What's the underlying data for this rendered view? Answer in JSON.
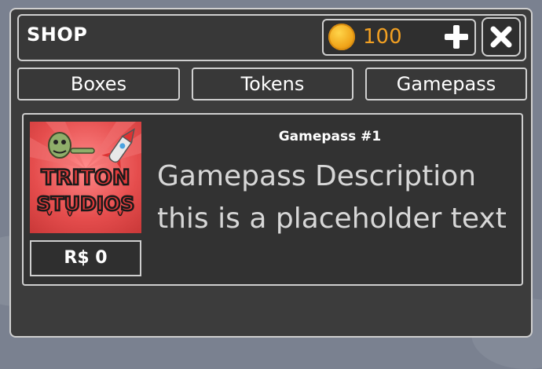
{
  "header": {
    "title": "SHOP",
    "coins": "100"
  },
  "tabs": [
    {
      "label": "Boxes"
    },
    {
      "label": "Tokens"
    },
    {
      "label": "Gamepass"
    }
  ],
  "item": {
    "title": "Gamepass #1",
    "description_line1": "Gamepass Description",
    "description_line2": "this is a placeholder text",
    "price": "R$ 0",
    "thumbnail_logo": "TRITON STUDIOS"
  },
  "colors": {
    "panel": "#3c3c3c",
    "border": "#cfcfcf",
    "coin_text": "#f2a022",
    "thumb_red": "#e54d4d"
  },
  "icons": [
    "coin-icon",
    "plus-icon",
    "close-icon"
  ]
}
